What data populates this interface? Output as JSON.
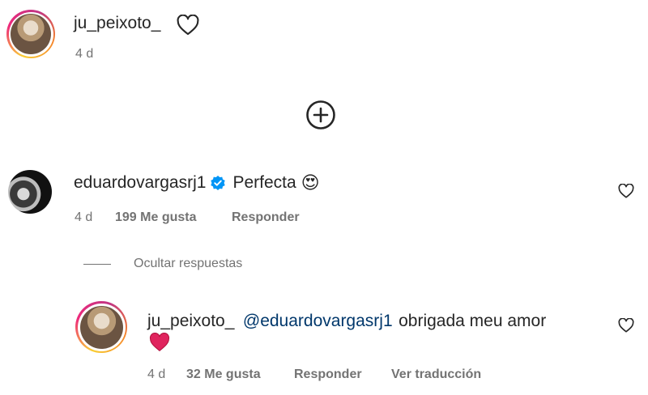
{
  "post_author": {
    "username": "ju_peixoto_",
    "time": "4 d"
  },
  "load_more": {
    "icon": "plus-circle-icon"
  },
  "comment": {
    "username": "eduardovargasrj1",
    "text": "Perfecta",
    "emoji": "😍",
    "time": "4 d",
    "likes": "199 Me gusta",
    "reply": "Responder"
  },
  "hide_replies": "Ocultar respuestas",
  "reply_comment": {
    "username": "ju_peixoto_",
    "mention": "@eduardovargasrj1",
    "text": "obrigada meu amor",
    "emoji": "❤️",
    "time": "4 d",
    "likes": "32 Me gusta",
    "reply": "Responder",
    "translate": "Ver traducción"
  },
  "colors": {
    "verified": "#0095f6",
    "heart_red": "#e0245e",
    "mention": "#00376b",
    "muted": "#737373"
  }
}
